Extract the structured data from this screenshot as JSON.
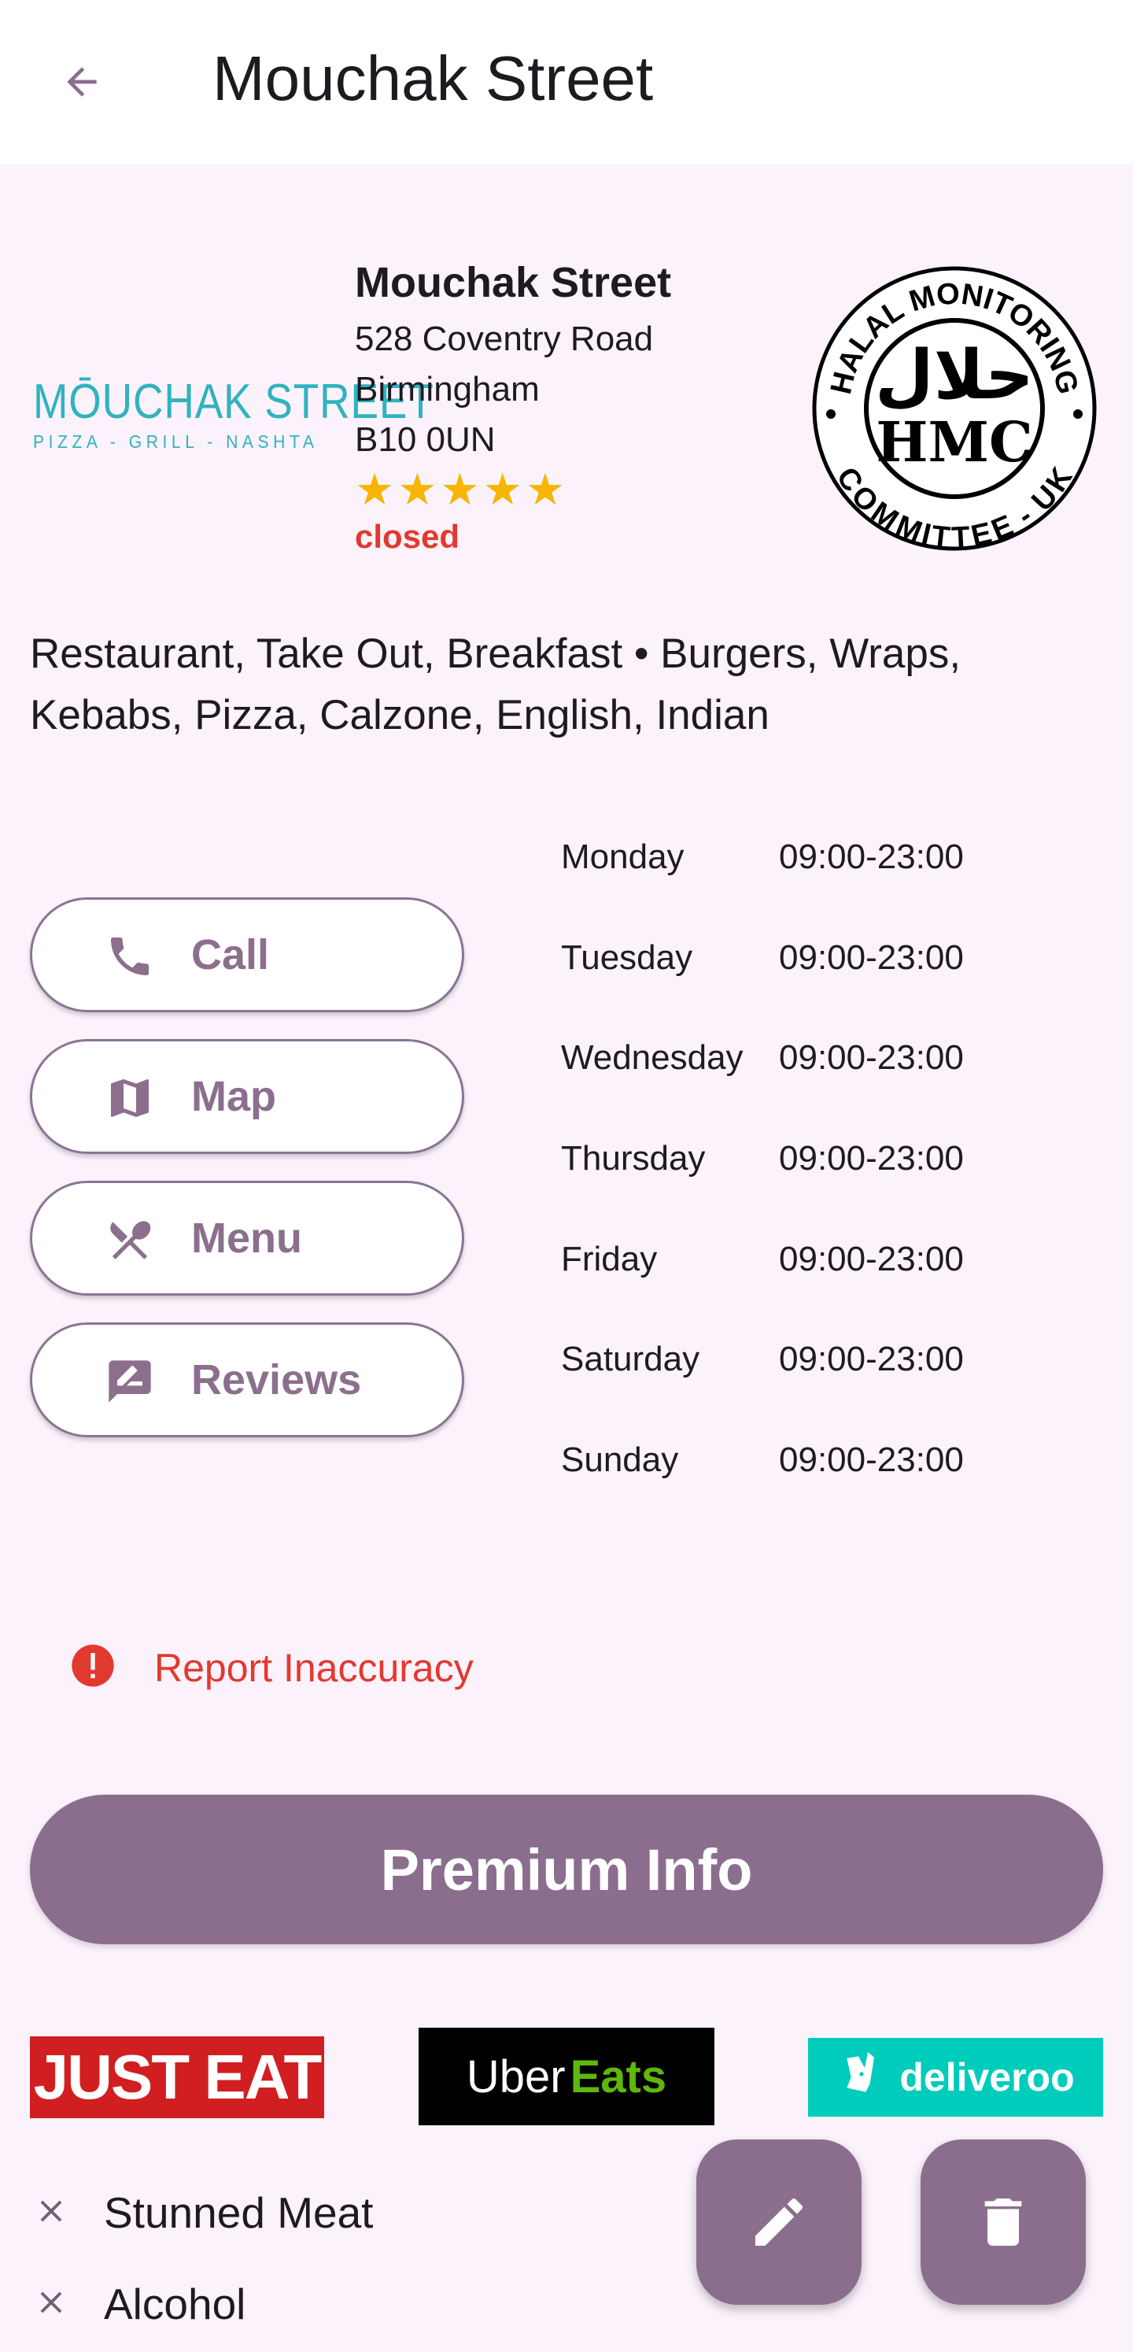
{
  "appbar": {
    "title": "Mouchak Street",
    "back_icon": "arrow-back-icon"
  },
  "restaurant": {
    "logo_main": "MŌUCHAK STREET",
    "logo_sub": "PIZZA - GRILL - NASHTA",
    "name": "Mouchak Street",
    "address_line1": "528 Coventry Road",
    "address_line2": "Birmingham",
    "address_line3": "B10 0UN",
    "rating": 5,
    "rating_max": 5,
    "status": "closed",
    "status_color": "#e2392f",
    "certification": {
      "top_text": "HALAL MONITORING",
      "bottom_text": "COMMITTEE - UK",
      "center_text": "HMC",
      "arabic_text": "حلال"
    },
    "categories": "Restaurant, Take Out, Breakfast  •  Burgers, Wraps, Kebabs, Pizza, Calzone, English, Indian"
  },
  "actions": [
    {
      "label": "Call",
      "icon": "phone-icon"
    },
    {
      "label": "Map",
      "icon": "map-icon"
    },
    {
      "label": "Menu",
      "icon": "restaurant-icon"
    },
    {
      "label": "Reviews",
      "icon": "rate-review-icon"
    }
  ],
  "hours": [
    {
      "day": "Monday",
      "time": "09:00-23:00"
    },
    {
      "day": "Tuesday",
      "time": "09:00-23:00"
    },
    {
      "day": "Wednesday",
      "time": "09:00-23:00"
    },
    {
      "day": "Thursday",
      "time": "09:00-23:00"
    },
    {
      "day": "Friday",
      "time": "09:00-23:00"
    },
    {
      "day": "Saturday",
      "time": "09:00-23:00"
    },
    {
      "day": "Sunday",
      "time": "09:00-23:00"
    }
  ],
  "report": {
    "label": "Report Inaccuracy",
    "icon": "error-icon"
  },
  "premium": {
    "label": "Premium Info"
  },
  "delivery": {
    "just_eat": "JUST EAT",
    "uber_1": "Uber",
    "uber_2": "Eats",
    "deliveroo": "deliveroo"
  },
  "attributes": [
    {
      "label": "Stunned Meat",
      "icon": "close-icon"
    },
    {
      "label": "Alcohol",
      "icon": "close-icon"
    }
  ],
  "fabs": {
    "edit_icon": "edit-icon",
    "delete_icon": "delete-icon"
  },
  "colors": {
    "accent": "#8b6e8e",
    "background": "#fbf2fb",
    "star": "#f7b500",
    "teal_logo": "#2fb3bf"
  }
}
